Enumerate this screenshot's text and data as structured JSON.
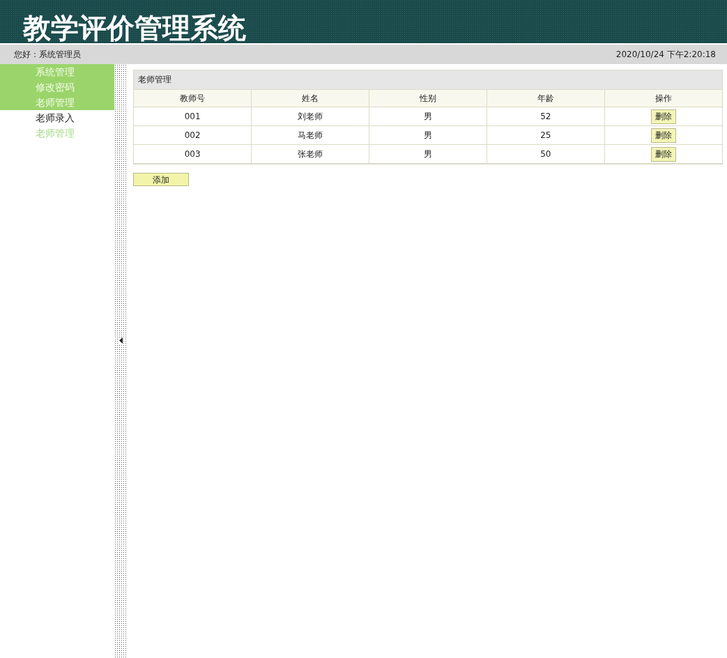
{
  "header": {
    "title": "教学评价管理系统"
  },
  "status_bar": {
    "greeting": "您好：系统管理员",
    "datetime": "2020/10/24 下午2:20:18"
  },
  "sidebar": {
    "items": [
      {
        "kind": "header",
        "label": "系统管理"
      },
      {
        "kind": "header",
        "label": "修改密码"
      },
      {
        "kind": "header",
        "label": "老师管理"
      },
      {
        "kind": "link",
        "label": "老师录入",
        "selected": false
      },
      {
        "kind": "link",
        "label": "老师管理",
        "selected": true
      }
    ]
  },
  "panel": {
    "title": "老师管理",
    "table": {
      "columns": [
        "教师号",
        "姓名",
        "性别",
        "年龄",
        "操作"
      ],
      "rows": [
        {
          "cells": [
            "001",
            "刘老师",
            "男",
            "52"
          ],
          "action": "删除"
        },
        {
          "cells": [
            "002",
            "马老师",
            "男",
            "25"
          ],
          "action": "删除"
        },
        {
          "cells": [
            "003",
            "张老师",
            "男",
            "50"
          ],
          "action": "删除"
        }
      ]
    },
    "add_button": "添加"
  }
}
